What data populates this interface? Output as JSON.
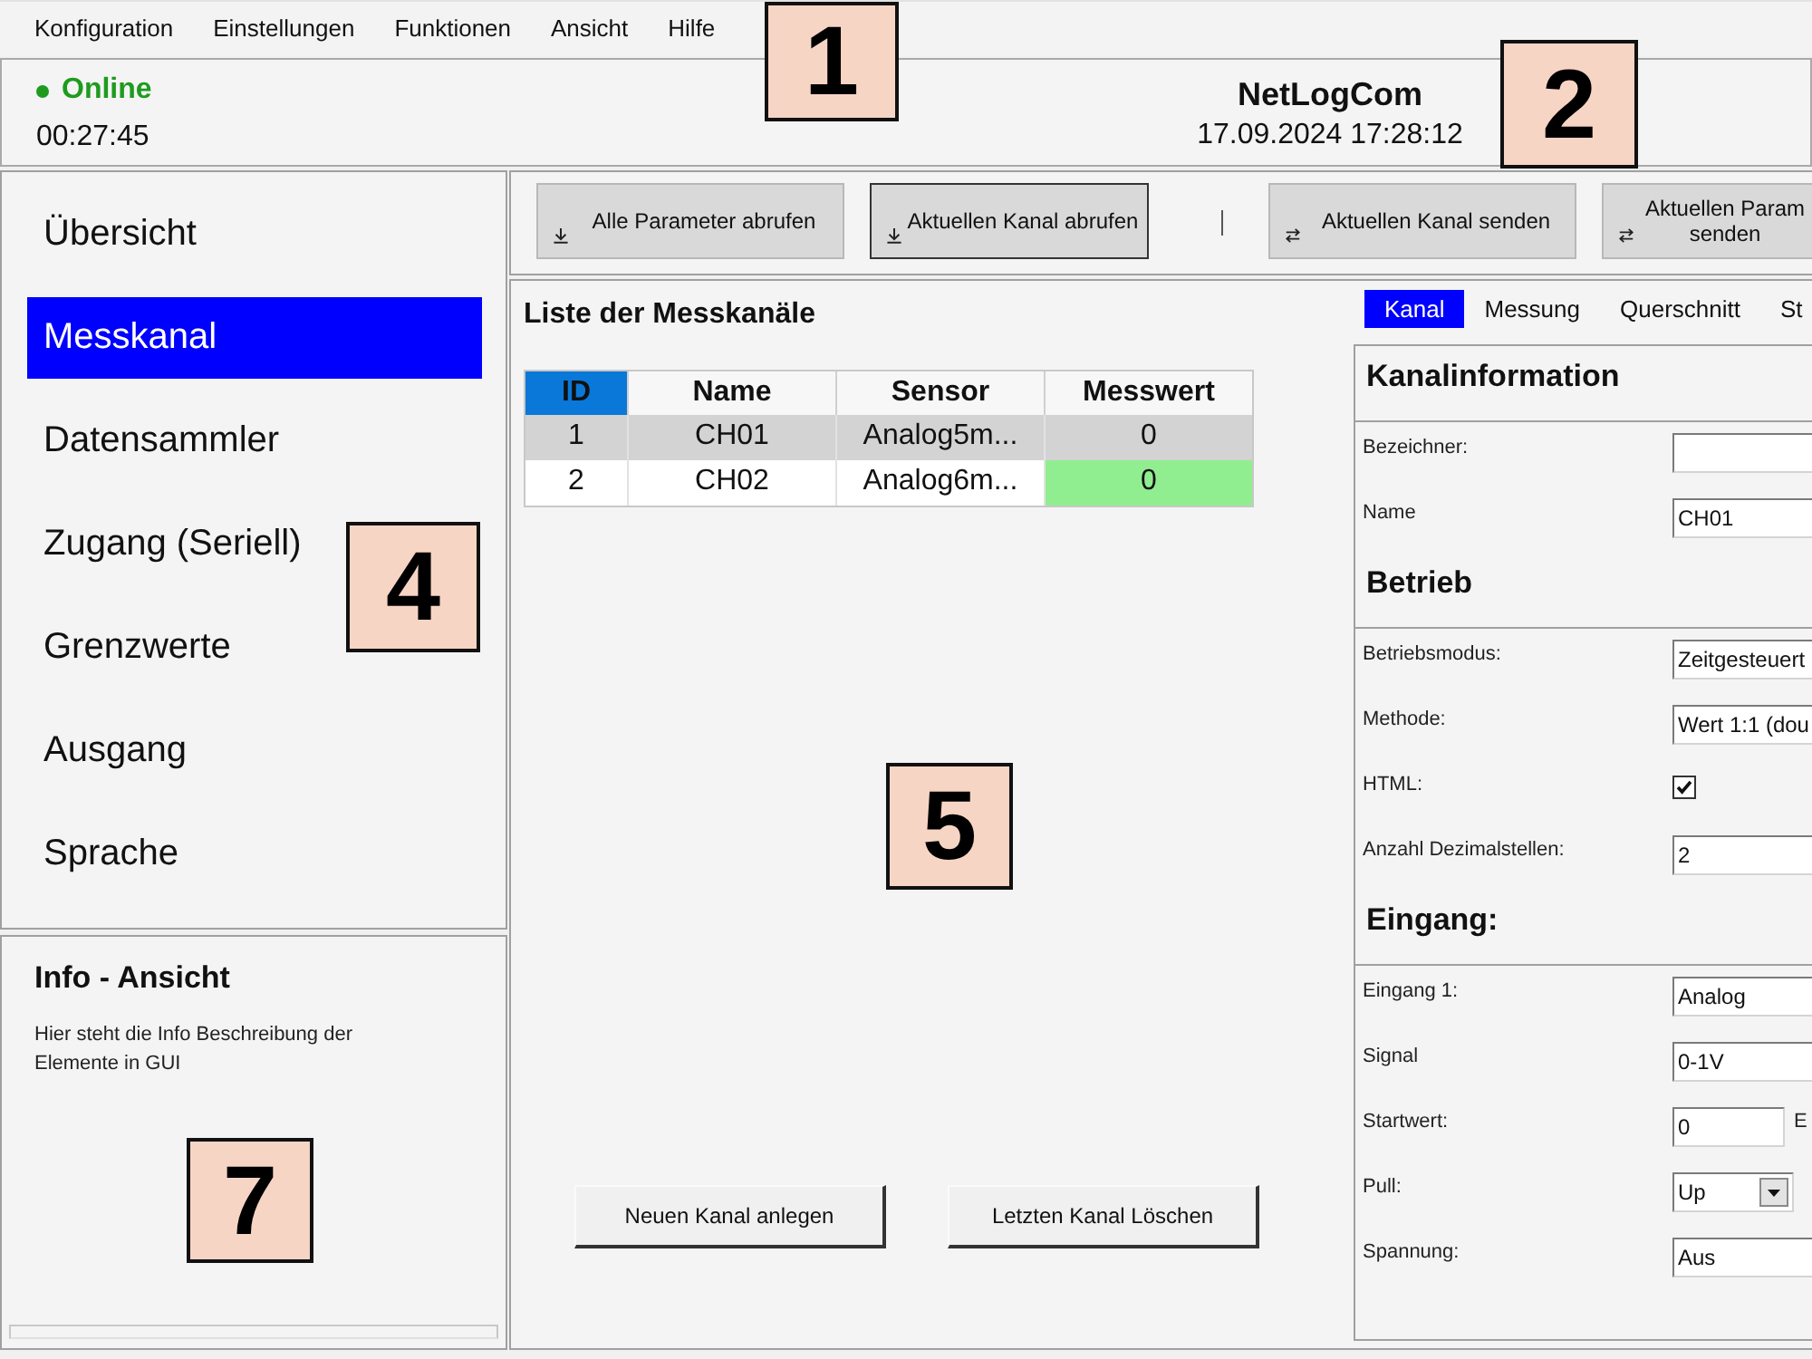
{
  "menu_bar": {
    "items": [
      "Konfiguration",
      "Einstellungen",
      "Funktionen",
      "Ansicht",
      "Hilfe"
    ],
    "callout": "1"
  },
  "header": {
    "status": {
      "label": "Online",
      "online": true
    },
    "session_time": "00:27:45",
    "app_title": "NetLogCom",
    "datetime": "17.09.2024 17:28:12",
    "callout": "2"
  },
  "sidebar": {
    "items": [
      {
        "label": "Übersicht",
        "selected": false
      },
      {
        "label": "Messkanal",
        "selected": true
      },
      {
        "label": "Datensammler",
        "selected": false
      },
      {
        "label": "Zugang (Seriell)",
        "selected": false
      },
      {
        "label": "Grenzwerte",
        "selected": false
      },
      {
        "label": "Ausgang",
        "selected": false
      },
      {
        "label": "Sprache",
        "selected": false
      }
    ],
    "callout": "4"
  },
  "info_panel": {
    "title": "Info - Ansicht",
    "text": "Hier steht die Info Beschreibung der Elemente in GUI",
    "callout": "7"
  },
  "toolbar": {
    "groups": [
      {
        "buttons": [
          {
            "label": "Alle Parameter abrufen",
            "kind": "download",
            "focused": false
          },
          {
            "label": "Aktuellen Kanal abrufen",
            "kind": "download",
            "focused": true
          }
        ]
      },
      {
        "buttons": [
          {
            "label": "Aktuellen Kanal senden",
            "kind": "send",
            "focused": false
          },
          {
            "label": "Aktuellen Param senden",
            "kind": "send",
            "focused": false
          }
        ]
      }
    ]
  },
  "channel_list": {
    "title": "Liste der Messkanäle",
    "columns": [
      {
        "label": "ID",
        "selected": true
      },
      {
        "label": "Name",
        "selected": false
      },
      {
        "label": "Sensor",
        "selected": false
      },
      {
        "label": "Messwert",
        "selected": false
      }
    ],
    "rows": [
      {
        "cells": [
          "1",
          "CH01",
          "Analog5m...",
          "0"
        ],
        "selected": true
      },
      {
        "cells": [
          "2",
          "CH02",
          "Analog6m...",
          "0"
        ],
        "selected": false,
        "color": "#90ee90"
      }
    ],
    "buttons": [
      "Neuen Kanal anlegen",
      "Letzten Kanal Löschen"
    ],
    "callout": "5"
  },
  "detail": {
    "tabs": [
      {
        "label": "Kanal",
        "selected": true
      },
      {
        "label": "Messung",
        "selected": false
      },
      {
        "label": "Querschnitt",
        "selected": false
      },
      {
        "label": "St",
        "selected": false
      }
    ],
    "sections": [
      {
        "heading": "Kanalinformation",
        "fields": [
          {
            "label": "Bezeichner:",
            "kind": "text"
          },
          {
            "label": "Name",
            "kind": "text",
            "value": "CH01"
          }
        ]
      },
      {
        "heading": "Betrieb",
        "fields": [
          {
            "label": "Betriebsmodus:",
            "kind": "text",
            "value": "Zeitgesteuert"
          },
          {
            "label": "Methode:",
            "kind": "text",
            "value": "Wert 1:1 (dou"
          },
          {
            "label": "HTML:",
            "kind": "checkbox",
            "checked": true
          },
          {
            "label": "Anzahl Dezimalstellen:",
            "kind": "text",
            "value": "2"
          }
        ]
      },
      {
        "heading": "Eingang:",
        "fields": [
          {
            "label": "Eingang 1:",
            "kind": "text",
            "value": "Analog"
          },
          {
            "label": "Signal",
            "kind": "text",
            "value": "0-1V"
          },
          {
            "label": "Startwert:",
            "kind": "number",
            "value": "0",
            "unit": "E"
          },
          {
            "label": "Pull:",
            "kind": "dropdown",
            "value": "Up"
          },
          {
            "label": "Spannung:",
            "kind": "text",
            "value": "Aus"
          }
        ]
      }
    ]
  }
}
